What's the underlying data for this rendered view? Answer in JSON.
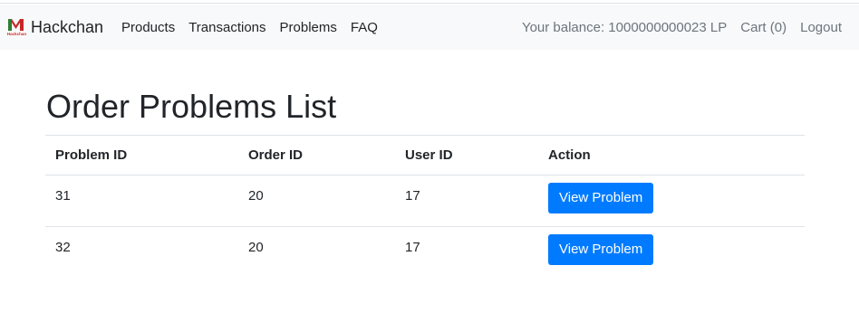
{
  "navbar": {
    "brand": "Hackchan",
    "logo_icon": "hackchan-logo-icon",
    "links": [
      {
        "label": "Products"
      },
      {
        "label": "Transactions"
      },
      {
        "label": "Problems"
      },
      {
        "label": "FAQ"
      }
    ],
    "balance": "Your balance: 1000000000023 LP",
    "cart": "Cart (0)",
    "logout": "Logout"
  },
  "main": {
    "title": "Order Problems List",
    "table": {
      "headers": [
        "Problem ID",
        "Order ID",
        "User ID",
        "Action"
      ],
      "rows": [
        {
          "problem_id": "31",
          "order_id": "20",
          "user_id": "17",
          "action": "View Problem"
        },
        {
          "problem_id": "32",
          "order_id": "20",
          "user_id": "17",
          "action": "View Problem"
        }
      ]
    }
  },
  "colors": {
    "navbar_bg": "#f8f9fa",
    "primary": "#007bff",
    "muted": "#6c757d"
  }
}
